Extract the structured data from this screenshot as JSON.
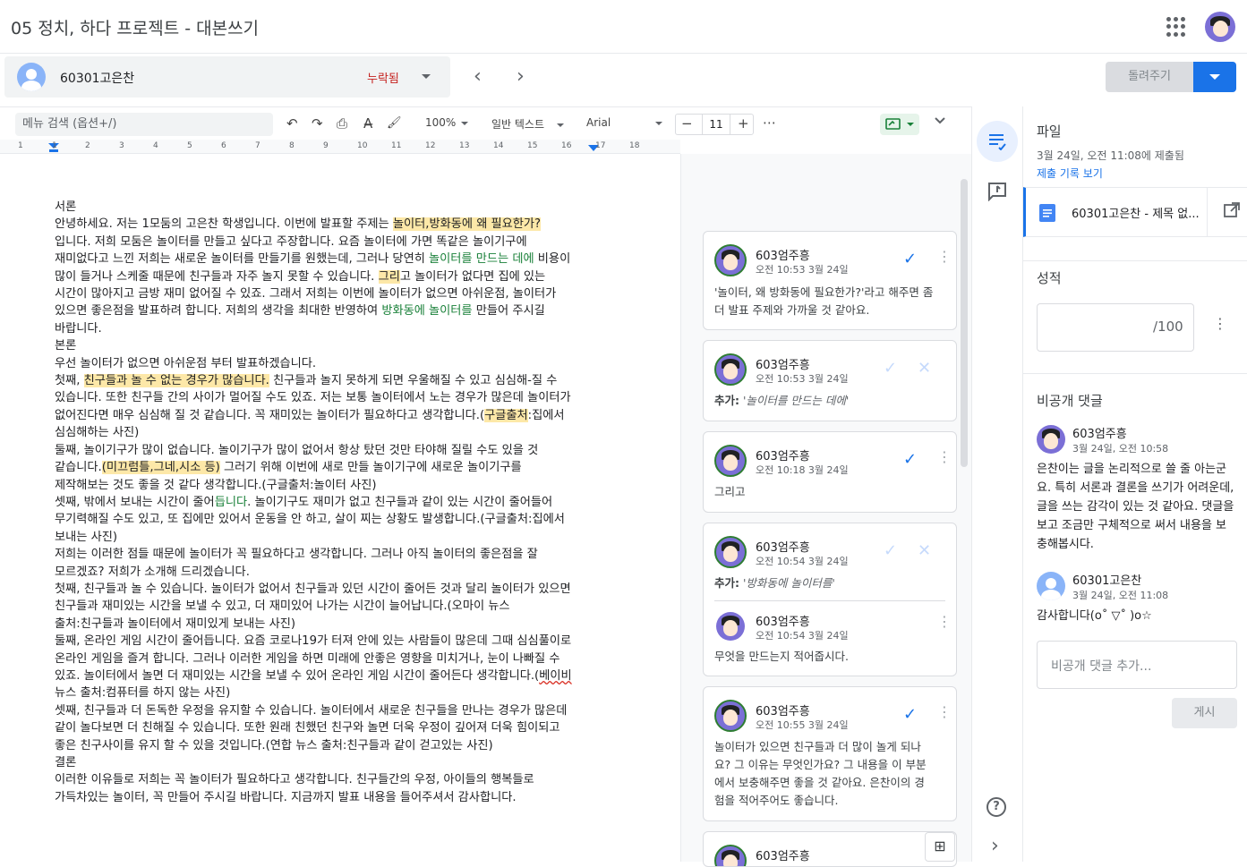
{
  "header": {
    "title": "05 정치, 하다 프로젝트 - 대본쓰기"
  },
  "student": {
    "name": "60301고은찬",
    "status": "누락됨"
  },
  "actions": {
    "return_label": "돌려주기"
  },
  "toolbar": {
    "menu_search_placeholder": "메뉴 검색 (옵션+/)",
    "zoom": "100%",
    "style": "일반 텍스트",
    "font": "Arial",
    "font_size": "11",
    "minus": "−",
    "plus": "+",
    "more": "⋯"
  },
  "ruler": {
    "numbers": [
      "1",
      "1",
      "2",
      "3",
      "4",
      "5",
      "6",
      "7",
      "8",
      "9",
      "10",
      "11",
      "12",
      "13",
      "14",
      "15",
      "16",
      "17",
      "18"
    ]
  },
  "document": {
    "lines": [
      [
        {
          "t": "서론"
        }
      ],
      [
        {
          "t": "안녕하세요. 저는 1모둠의 고은찬 학생입니다. 이번에 발표할 주제는 "
        },
        {
          "t": "놀이터,방화동에 왜 필요한가?",
          "c": "hl"
        }
      ],
      [
        {
          "t": "입니다. 저희 모둠은 놀이터를 만들고 싶다고 주장합니다. 요즘 놀이터에 가면 똑같은 놀이기구에"
        }
      ],
      [
        {
          "t": "재미없다고 느낀 저희는 새로운 놀이터를 만들기를 원했는데, 그러나 당연히 "
        },
        {
          "t": "놀이터를 만드는 데에",
          "c": "grn"
        },
        {
          "t": " 비용이"
        }
      ],
      [
        {
          "t": "많이 들거나 스케줄 때문에 친구들과 자주 놀지 못할 수 있습니다. "
        },
        {
          "t": "그리",
          "c": "hl"
        },
        {
          "t": "고 놀이터가 없다면 집에 있는"
        }
      ],
      [
        {
          "t": "시간이 많아지고 금방 재미 없어질 수 있죠. 그래서 저희는 이번에 놀이터가 없으면 아쉬운점, 놀이터가"
        }
      ],
      [
        {
          "t": "있으면 좋은점을 발표하려 합니다. 저희의 생각을 최대한 반영하여 "
        },
        {
          "t": "방화동에 놀이터를",
          "c": "grn"
        },
        {
          "t": " 만들어 주시길"
        }
      ],
      [
        {
          "t": "바랍니다."
        }
      ],
      [
        {
          "t": " "
        }
      ],
      [
        {
          "t": "본론"
        }
      ],
      [
        {
          "t": "우선 놀이터가 없으면 아쉬운점 부터 발표하겠습니다."
        }
      ],
      [
        {
          "t": "첫째, "
        },
        {
          "t": "친구들과 놀 수 없는 경우가 많습니다.",
          "c": "hl"
        },
        {
          "t": " 친구들과 놀지 못하게 되면 우울해질 수 있고 심심해-질 수"
        }
      ],
      [
        {
          "t": "있습니다. 또한 친구들 간의 사이가 멀어질 수도 있죠. 저는 보통 놀이터에서 노는 경우가 많은데 놀이터가"
        }
      ],
      [
        {
          "t": "없어진다면 매우 심심해 질 것 같습니다. 꼭 재미있는 놀이터가 필요하다고 생각합니다.("
        },
        {
          "t": "구글출처",
          "c": "hl"
        },
        {
          "t": ":집에서"
        }
      ],
      [
        {
          "t": "심심해하는 사진)"
        }
      ],
      [
        {
          "t": "둘째, 놀이기구가 많이 없습니다. 놀이기구가 많이 없어서 항상 탔던 것만 타야해 질릴 수도 있을 것"
        }
      ],
      [
        {
          "t": "같습니다."
        },
        {
          "t": "(미끄럼틀,그네,시소 등)",
          "c": "hl"
        },
        {
          "t": " 그러기 위해 이번에 새로 만들 놀이기구에 새로운 놀이기구를"
        }
      ],
      [
        {
          "t": "제작해보는 것도 좋을 것 같다 생각합니다.(구글출처:놀이터 사진)"
        }
      ],
      [
        {
          "t": "셋째, 밖에서 보내는 시간이 줄어"
        },
        {
          "t": "듭니다",
          "c": "grn"
        },
        {
          "t": ". 놀이기구도 재미가 없고 친구들과 같이 있는 시간이 줄어들어"
        }
      ],
      [
        {
          "t": "무기력해질 수도 있고, 또 집에만 있어서 운동을 안 하고, 살이 찌는 상황도 발생합니다.(구글출처:집에서"
        }
      ],
      [
        {
          "t": "보내는 사진)"
        }
      ],
      [
        {
          "t": " "
        }
      ],
      [
        {
          "t": "저희는 이러한 점들 때문에 놀이터가 꼭 필요하다고 생각합니다. 그러나 아직 놀이터의 좋은점을 잘"
        }
      ],
      [
        {
          "t": "모르겠죠? 저희가 소개해 드리겠습니다."
        }
      ],
      [
        {
          "t": "첫째, 친구들과 놀 수 있습니다. 놀이터가 없어서 친구들과 있던 시간이 줄어든 것과 달리 놀이터가 있으면"
        }
      ],
      [
        {
          "t": "친구들과 재미있는 시간을 보낼 수 있고, 더 재미있어 나가는 시간이 늘어납니다.(오마이 뉴스"
        }
      ],
      [
        {
          "t": "출처:친구들과 놀이터에서 재미있게 보내는 사진)"
        }
      ],
      [
        {
          "t": "둘째, 온라인 게임 시간이 줄어듭니다. 요즘 코로나19가 터져 안에 있는 사람들이 많은데 그때 심심풀이로"
        }
      ],
      [
        {
          "t": "온라인 게임을 즐겨 합니다. 그러나 이러한 게임을 하면 미래에 안좋은 영향을 미치거나, 눈이 나빠질 수"
        }
      ],
      [
        {
          "t": "있죠. 놀이터에서 놀면 더 재미있는 시간을 보낼 수 있어 온라인 게임 시간이 줄어든다 생각합니다.("
        },
        {
          "t": "베이비",
          "c": "red-ul"
        }
      ],
      [
        {
          "t": "뉴스 출처:컴퓨터를 하지 않는 사진)"
        }
      ],
      [
        {
          "t": "셋째, 친구들과 더 돈독한 우정을 유지할 수 있습니다. 놀이터에서 새로운 친구들을 만나는 경우가 많은데"
        }
      ],
      [
        {
          "t": "같이 놀다보면 더 친해질 수 있습니다. 또한 원래 친했던 친구와 놀면 더욱 우정이 깊어져 더욱 힘이되고"
        }
      ],
      [
        {
          "t": "좋은 친구사이를 유지 할 수 있을 것입니다.(연합 뉴스 출처:친구들과 같이 걷고있는 사진)"
        }
      ],
      [
        {
          "t": " "
        }
      ],
      [
        {
          "t": "결론"
        }
      ],
      [
        {
          "t": "이러한 이유들로 저희는 꼭 놀이터가 필요하다고 생각합니다. 친구들간의 우정, 아이들의 행복들로"
        }
      ],
      [
        {
          "t": "가득차있는 놀이터, 꼭 만들어 주시길 바랍니다. 지금까지 발표 내용을 들어주셔서 감사합니다."
        }
      ]
    ]
  },
  "comments": [
    {
      "author": "603엄주흥",
      "time": "오전 10:53 3월 24일",
      "body": [
        "'놀이터, 왜 방화동에 필요한가?'라고 해주면 좀",
        "더 발표 주제와 가까울 것 같아요."
      ],
      "resolved": true
    },
    {
      "author": "603엄주흥",
      "time": "오전 10:53 3월 24일",
      "prefix": "추가:",
      "quote": "'놀이터를 만드는 데에'",
      "suggestion": true
    },
    {
      "author": "603엄주흥",
      "time": "오전 10:18 3월 24일",
      "body": [
        "그리고"
      ],
      "resolved": true
    },
    {
      "author": "603엄주흥",
      "time": "오전 10:54 3월 24일",
      "prefix": "추가:",
      "quote": "'방화동에 놀이터를'",
      "suggestion": true,
      "reply": {
        "author": "603엄주흥",
        "time": "오전 10:54 3월 24일",
        "body": "무엇을 만드는지 적어줍시다."
      }
    },
    {
      "author": "603엄주흥",
      "time": "오전 10:55 3월 24일",
      "body": [
        "놀이터가 있으면 친구들과 더 많이 놀게 되나",
        "요? 그 이유는 무엇인가요? 그 내용을 이 부분",
        "에서 보충해주면 좋을 것 같아요. 은찬이의 경",
        "험을 적어주어도 좋습니다."
      ],
      "resolved": true
    },
    {
      "author": "603엄주흥"
    }
  ],
  "panel": {
    "file_heading": "파일",
    "submitted": "3월 24일, 오전 11:08에 제출됨",
    "history_link": "제출 기록 보기",
    "file_name": "60301고은찬 - 제목 없...",
    "grade_heading": "성적",
    "grade_suffix": "/100",
    "private_heading": "비공개 댓글",
    "private_comments": [
      {
        "author": "603엄주흥",
        "time": "3월 24일, 오전 10:58",
        "body": [
          "은찬이는 글을 논리적으로 쓸 줄 아는군",
          "요. 특히 서론과 결론을 쓰기가 어려운데,",
          "글을 쓰는 감각이 있는 것 같아요. 댓글을",
          "보고 조금만 구체적으로 써서 내용을 보",
          "충해봅시다."
        ]
      },
      {
        "author": "60301고은찬",
        "time": "3월 24일, 오전 11:08",
        "body": [
          "감사합니다(o˚ ▽˚ )o☆"
        ]
      }
    ],
    "comment_placeholder": "비공개 댓글 추가...",
    "post_label": "게시"
  },
  "icons": {
    "undo": "↶",
    "redo": "↷",
    "print": "⎙",
    "spell": "A̶",
    "paint": "🖌",
    "check": "✓",
    "close": "✕",
    "dots": "⋮",
    "help": "?",
    "chevron": "›",
    "comment_icon": "💬",
    "doc_icon": "≣",
    "open_icon": "↗",
    "fab": "⊞"
  },
  "colors": {
    "accent": "#1a73e8",
    "missing": "#c5221f",
    "highlight": "#fde8a8",
    "suggest": "#188038"
  }
}
